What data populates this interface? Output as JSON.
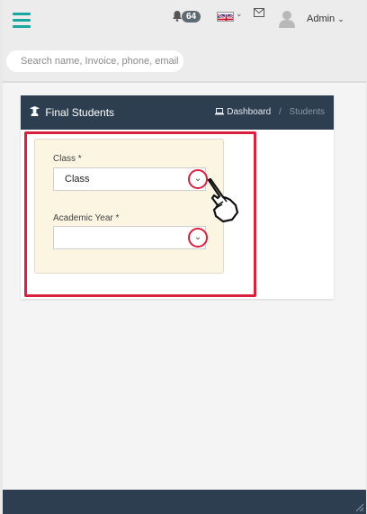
{
  "header": {
    "notifications_count": "64",
    "user_name": "Admin",
    "search_placeholder": "Search name, Invoice, phone, email"
  },
  "card": {
    "title": "Final Students",
    "breadcrumb": {
      "dashboard": "Dashboard",
      "separator": "/",
      "current": "Students"
    }
  },
  "form": {
    "class_label": "Class *",
    "class_value": "Class",
    "academic_year_label": "Academic Year *",
    "academic_year_value": ""
  },
  "colors": {
    "accent": "#1aa6a0",
    "header_dark": "#2c3e50",
    "highlight": "#d9213f",
    "form_bg": "#fcf5e1"
  }
}
